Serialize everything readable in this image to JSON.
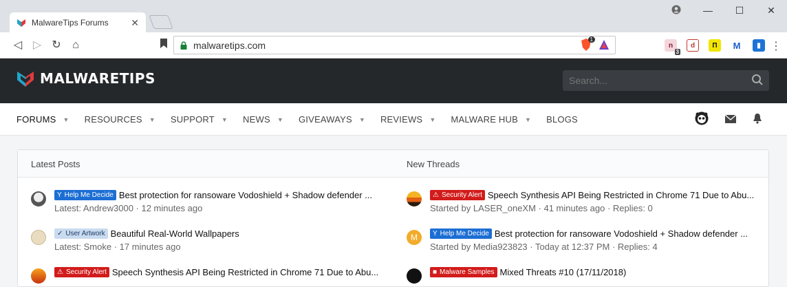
{
  "browser": {
    "tab_title": "MalwareTips Forums",
    "tab_close": "✕",
    "url": "malwaretips.com",
    "extension_badges": {
      "n": "3"
    },
    "brave_badge": "1"
  },
  "site": {
    "logo_text": "MALWARETIPS",
    "search_placeholder": "Search..."
  },
  "nav": {
    "items": [
      {
        "label": "FORUMS",
        "has_caret": true
      },
      {
        "label": "RESOURCES",
        "has_caret": true
      },
      {
        "label": "SUPPORT",
        "has_caret": true
      },
      {
        "label": "NEWS",
        "has_caret": true
      },
      {
        "label": "GIVEAWAYS",
        "has_caret": true
      },
      {
        "label": "REVIEWS",
        "has_caret": true
      },
      {
        "label": "MALWARE HUB",
        "has_caret": true
      },
      {
        "label": "BLOGS",
        "has_caret": false
      }
    ],
    "caret": "▼"
  },
  "panel": {
    "left_title": "Latest Posts",
    "right_title": "New Threads",
    "latest_posts": [
      {
        "label": "Help Me Decide",
        "label_style": "blue",
        "title": "Best protection for ransoware Vodoshield + Shadow defender ...",
        "meta": "Latest: Andrew3000 · 12 minutes ago"
      },
      {
        "label": "User Artwork",
        "label_style": "light",
        "title": "Beautiful Real-World Wallpapers",
        "meta": "Latest: Smoke · 17 minutes ago"
      },
      {
        "label": "Security Alert",
        "label_style": "red",
        "title": "Speech Synthesis API Being Restricted in Chrome 71 Due to Abu...",
        "meta": ""
      }
    ],
    "new_threads": [
      {
        "label": "Security Alert",
        "label_style": "red",
        "title": "Speech Synthesis API Being Restricted in Chrome 71 Due to Abu...",
        "meta": "Started by LASER_oneXM · 41 minutes ago · Replies: 0"
      },
      {
        "label": "Help Me Decide",
        "label_style": "blue",
        "title": "Best protection for ransoware Vodoshield + Shadow defender ...",
        "meta": "Started by Media923823 · Today at 12:37 PM · Replies: 4",
        "avatar_letter": "M"
      },
      {
        "label": "Malware Samples",
        "label_style": "red",
        "title": "Mixed Threats #10 (17/11/2018)",
        "meta": ""
      }
    ]
  },
  "colors": {
    "header_bg": "#25282b",
    "label_blue": "#1c6ed4",
    "label_red": "#d21b1b",
    "accent_teal": "#1ea7c9"
  }
}
